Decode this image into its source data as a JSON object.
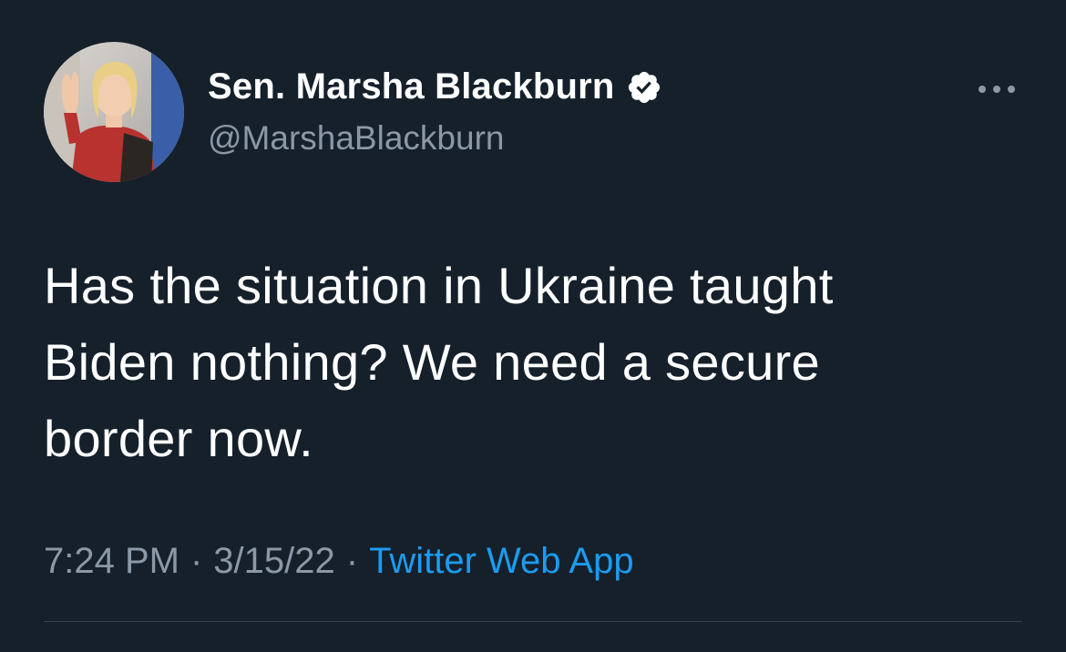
{
  "author": {
    "display_name": "Sen. Marsha Blackburn",
    "handle": "@MarshaBlackburn",
    "verified": true
  },
  "icons": {
    "verified": "verified-badge-icon",
    "more": "more-dots-icon"
  },
  "tweet": {
    "text_lines": [
      "Has the situation in Ukraine taught",
      "Biden nothing? We need a secure",
      "border now."
    ]
  },
  "meta": {
    "time": "7:24 PM",
    "separator": "·",
    "date": "3/15/22",
    "source": "Twitter Web App"
  },
  "colors": {
    "background": "#15202b",
    "text_primary": "#ffffff",
    "text_secondary": "#8b98a5",
    "link": "#1d9bf0",
    "divider": "#38444d"
  }
}
